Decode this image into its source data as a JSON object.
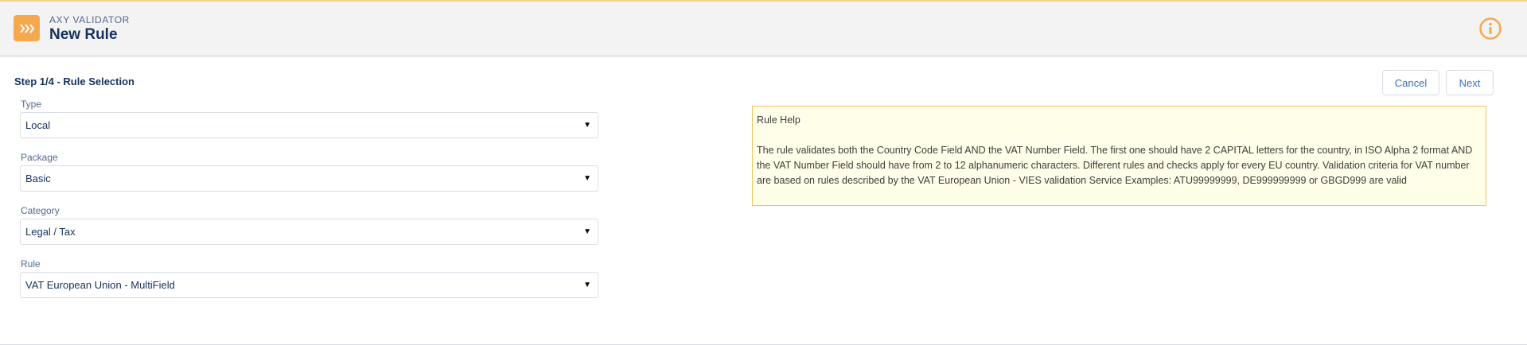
{
  "header": {
    "app_name": "AXY VALIDATOR",
    "title": "New Rule",
    "app_icon": "double-chevron-right-icon",
    "info_icon": "info-icon",
    "accent_color": "#f6a84e"
  },
  "step": {
    "title": "Step 1/4 - Rule Selection"
  },
  "buttons": {
    "cancel": "Cancel",
    "next": "Next"
  },
  "fields": {
    "type": {
      "label": "Type",
      "value": "Local"
    },
    "package": {
      "label": "Package",
      "value": "Basic"
    },
    "category": {
      "label": "Category",
      "value": "Legal / Tax"
    },
    "rule": {
      "label": "Rule",
      "value": "VAT European Union - MultiField"
    },
    "caret": "▼"
  },
  "help": {
    "title": "Rule Help",
    "body": "The rule validates both the Country Code Field AND the VAT Number Field. The first one should have 2 CAPITAL letters for the country, in ISO Alpha 2 format AND the VAT Number Field should have from 2 to 12 alphanumeric characters. Different rules and checks apply for every EU country. Validation criteria for VAT number are based on rules described by the VAT European Union - VIES validation Service Examples: ATU99999999, DE999999999 or GBGD999 are valid"
  }
}
